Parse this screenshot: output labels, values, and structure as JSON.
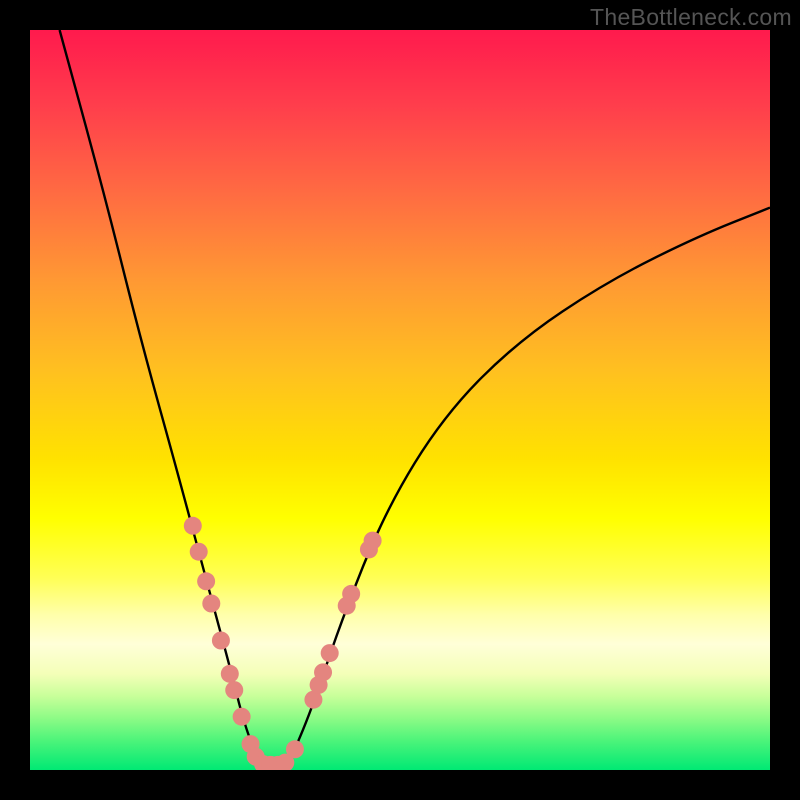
{
  "watermark": "TheBottleneck.com",
  "chart_data": {
    "type": "line",
    "title": "",
    "xlabel": "",
    "ylabel": "",
    "xlim": [
      0,
      100
    ],
    "ylim": [
      0,
      100
    ],
    "background_gradient": {
      "top_color": "#ff1a4d",
      "bottom_color": "#00e974",
      "meaning": "bottleneck severity (red=high, green=optimal)"
    },
    "series": [
      {
        "name": "left-curve",
        "type": "path",
        "points": [
          {
            "x": 4,
            "y": 100
          },
          {
            "x": 10,
            "y": 78
          },
          {
            "x": 15,
            "y": 58
          },
          {
            "x": 20,
            "y": 40
          },
          {
            "x": 24,
            "y": 25
          },
          {
            "x": 27,
            "y": 14
          },
          {
            "x": 29,
            "y": 6
          },
          {
            "x": 31,
            "y": 1
          }
        ]
      },
      {
        "name": "right-curve",
        "type": "path",
        "points": [
          {
            "x": 35,
            "y": 1
          },
          {
            "x": 38,
            "y": 8
          },
          {
            "x": 42,
            "y": 20
          },
          {
            "x": 48,
            "y": 35
          },
          {
            "x": 56,
            "y": 48
          },
          {
            "x": 66,
            "y": 58
          },
          {
            "x": 78,
            "y": 66
          },
          {
            "x": 90,
            "y": 72
          },
          {
            "x": 100,
            "y": 76
          }
        ]
      }
    ],
    "markers": {
      "name": "benchmark-dots",
      "color": "#e4857f",
      "radius": 9,
      "points": [
        {
          "x": 22.0,
          "y": 33.0
        },
        {
          "x": 22.8,
          "y": 29.5
        },
        {
          "x": 23.8,
          "y": 25.5
        },
        {
          "x": 24.5,
          "y": 22.5
        },
        {
          "x": 25.8,
          "y": 17.5
        },
        {
          "x": 27.0,
          "y": 13.0
        },
        {
          "x": 27.6,
          "y": 10.8
        },
        {
          "x": 28.6,
          "y": 7.2
        },
        {
          "x": 29.8,
          "y": 3.5
        },
        {
          "x": 30.5,
          "y": 1.8
        },
        {
          "x": 31.5,
          "y": 0.8
        },
        {
          "x": 32.5,
          "y": 0.7
        },
        {
          "x": 33.5,
          "y": 0.7
        },
        {
          "x": 34.5,
          "y": 1.0
        },
        {
          "x": 35.8,
          "y": 2.8
        },
        {
          "x": 38.3,
          "y": 9.5
        },
        {
          "x": 39.0,
          "y": 11.5
        },
        {
          "x": 39.6,
          "y": 13.2
        },
        {
          "x": 40.5,
          "y": 15.8
        },
        {
          "x": 42.8,
          "y": 22.2
        },
        {
          "x": 43.4,
          "y": 23.8
        },
        {
          "x": 45.8,
          "y": 29.8
        },
        {
          "x": 46.3,
          "y": 31.0
        }
      ]
    }
  }
}
